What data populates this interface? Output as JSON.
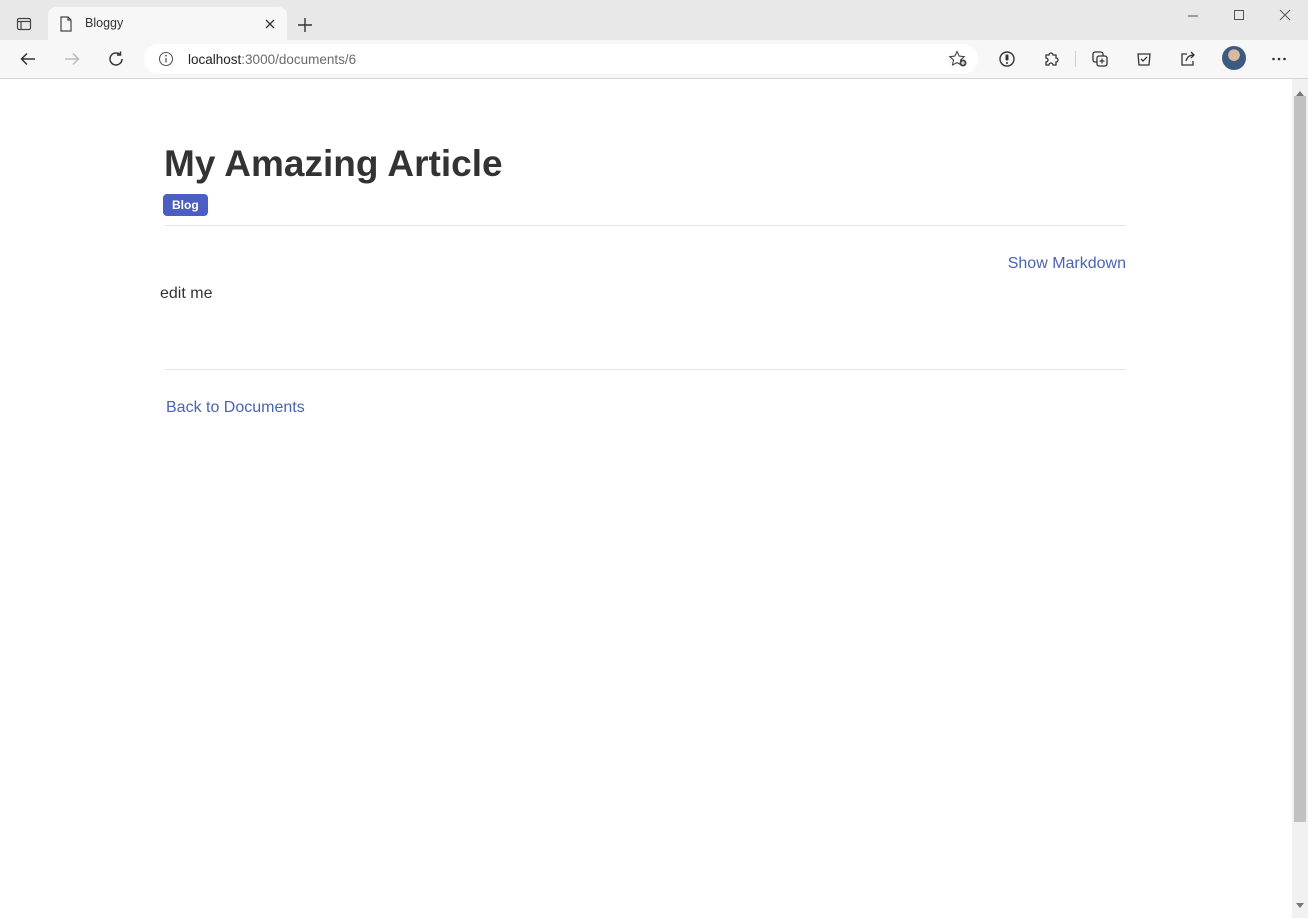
{
  "browser": {
    "tab": {
      "title": "Bloggy",
      "favicon": "page-icon"
    },
    "address": {
      "host": "localhost",
      "path": ":3000/documents/6"
    },
    "icons": {
      "tab_actions": "tab-actions-icon",
      "close": "close-icon",
      "new_tab": "plus-icon",
      "back": "arrow-left-icon",
      "forward": "arrow-right-icon",
      "refresh": "refresh-icon",
      "info": "info-icon",
      "favorite": "star-add-icon",
      "extensions": "puzzle-icon",
      "collections": "collections-icon",
      "more": "ellipsis-icon"
    }
  },
  "document": {
    "title": "My Amazing Article",
    "tag": "Blog",
    "show_markdown_label": "Show Markdown",
    "body": "edit me",
    "back_label": "Back to Documents"
  },
  "colors": {
    "accent": "#4a5fc1",
    "link": "#4a65b0",
    "text": "#333333"
  }
}
